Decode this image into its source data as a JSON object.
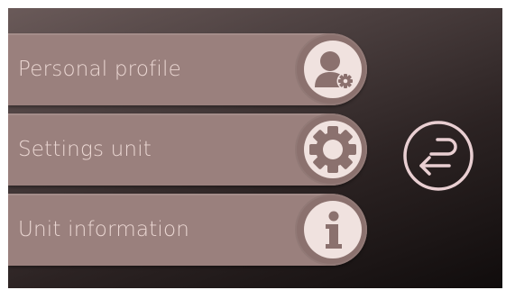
{
  "menu": {
    "items": [
      {
        "label": "Personal profile",
        "icon": "user-gear-icon"
      },
      {
        "label": "Settings unit",
        "icon": "gear-icon"
      },
      {
        "label": "Unit information",
        "icon": "info-icon"
      }
    ]
  },
  "back": {
    "icon": "back-arrow-icon"
  },
  "colors": {
    "button": "#9a807d",
    "icon_circle": "#f0e2df",
    "label": "#ead6d2",
    "back_outline": "#e9cfd2"
  }
}
